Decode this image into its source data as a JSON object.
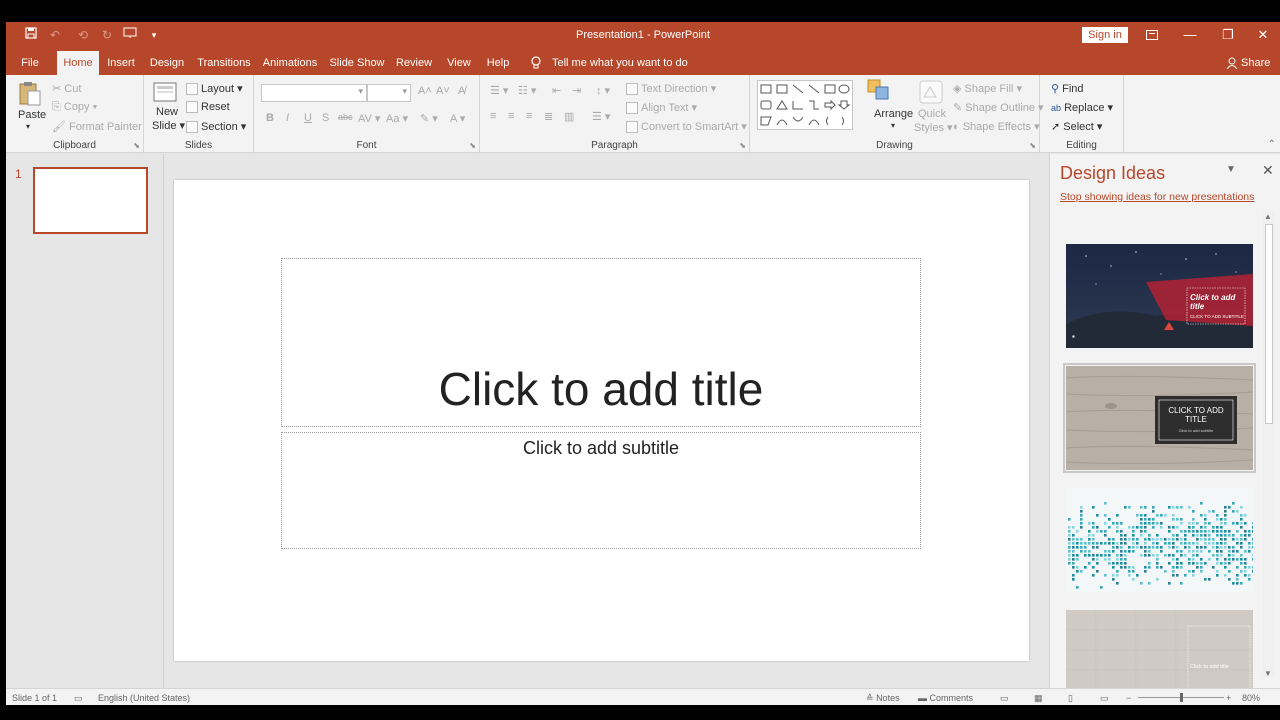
{
  "window": {
    "title": "Presentation1  -  PowerPoint",
    "sign_in": "Sign in"
  },
  "tabs": [
    {
      "label": "File"
    },
    {
      "label": "Home",
      "active": true
    },
    {
      "label": "Insert"
    },
    {
      "label": "Design"
    },
    {
      "label": "Transitions"
    },
    {
      "label": "Animations"
    },
    {
      "label": "Slide Show"
    },
    {
      "label": "Review"
    },
    {
      "label": "View"
    },
    {
      "label": "Help"
    }
  ],
  "tell_me": "Tell me what you want to do",
  "share": "Share",
  "ribbon": {
    "clipboard": {
      "label": "Clipboard",
      "paste": "Paste",
      "cut": "Cut",
      "copy": "Copy",
      "format_painter": "Format Painter"
    },
    "slides": {
      "label": "Slides",
      "new_slide_1": "New",
      "new_slide_2": "Slide",
      "layout": "Layout",
      "reset": "Reset",
      "section": "Section"
    },
    "font": {
      "label": "Font"
    },
    "paragraph": {
      "label": "Paragraph",
      "text_direction": "Text Direction",
      "align_text": "Align Text",
      "convert_smartart": "Convert to SmartArt"
    },
    "drawing": {
      "label": "Drawing",
      "arrange": "Arrange",
      "quick_styles_1": "Quick",
      "quick_styles_2": "Styles",
      "shape_fill": "Shape Fill",
      "shape_outline": "Shape Outline",
      "shape_effects": "Shape Effects"
    },
    "editing": {
      "label": "Editing",
      "find": "Find",
      "replace": "Replace",
      "select": "Select"
    }
  },
  "thumbnails": [
    {
      "number": "1"
    }
  ],
  "slide": {
    "title_placeholder": "Click to add title",
    "subtitle_placeholder": "Click to add subtitle"
  },
  "design_ideas": {
    "title": "Design Ideas",
    "stop_link": "Stop showing ideas for new presentations",
    "ideas": [
      {
        "title": "Click to add title",
        "subtitle": "CLICK TO ADD SUBTITLE"
      },
      {
        "title": "CLICK TO ADD TITLE",
        "subtitle": "Click to add subtitle"
      },
      {
        "title": "",
        "subtitle": ""
      },
      {
        "title": "Click to add title",
        "subtitle": ""
      }
    ]
  },
  "status": {
    "slide_of": "Slide 1 of 1",
    "language": "English (United States)",
    "notes": "Notes",
    "comments": "Comments",
    "zoom": "80%"
  },
  "colors": {
    "accent": "#b7472a",
    "ribbon_bg": "#f3f3f3",
    "workspace_bg": "#e6e6e6"
  }
}
